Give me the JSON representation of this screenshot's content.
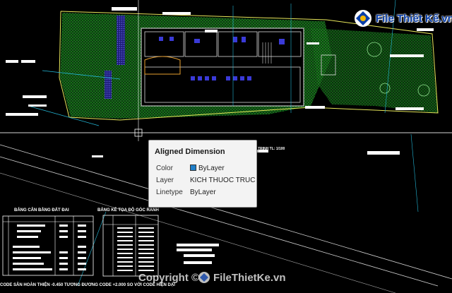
{
  "tooltip": {
    "title": "Aligned Dimension",
    "rows": [
      {
        "key": "Color",
        "value": "ByLayer",
        "swatch": "#1e7ec8"
      },
      {
        "key": "Layer",
        "value": "KICH THUOC TRUC"
      },
      {
        "key": "Linetype",
        "value": "ByLayer"
      }
    ]
  },
  "drawing": {
    "scale_note": "TRINH TL: 1/100",
    "table_left_title": "BẢNG CÂN BẰNG ĐẤT ĐAI",
    "table_right_title": "BẢNG KÊ TỌA ĐỘ GÓC RANH",
    "status_line": "CODE SÂN HOÀN THIỆN -0.450 TƯƠNG ĐƯƠNG CODE +2.000 SO VỚI CODE HIỆN DẠI"
  },
  "watermark": {
    "top_text": "File Thiết Kế.vn",
    "bottom_prefix": "Copyright ©",
    "bottom_text": "FileThietKe.vn"
  },
  "colors": {
    "background": "#000000",
    "site_green": "#1aa01a",
    "boundary_cyan": "#23b8d8",
    "road_yellow": "#e8e85a",
    "watermark_blue": "#0a3fa8"
  }
}
